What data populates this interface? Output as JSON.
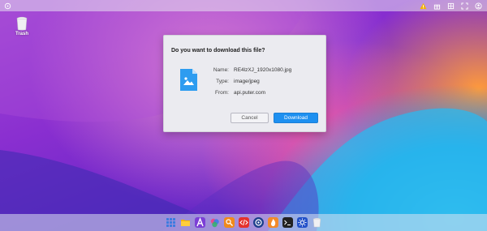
{
  "desktop": {
    "trash_label": "Trash"
  },
  "dialog": {
    "title": "Do you want to download this file?",
    "fields": [
      {
        "key": "Name:",
        "value": "RE4lzXJ_1920x1080.jpg"
      },
      {
        "key": "Type:",
        "value": "image/jpeg"
      },
      {
        "key": "From:",
        "value": "api.puter.com"
      }
    ],
    "cancel_label": "Cancel",
    "download_label": "Download"
  },
  "colors": {
    "accent": "#1e90f0",
    "file_icon": "#2d9cf0",
    "warning": "#f5b400"
  },
  "topbar": {
    "left_icon": "puter-logo-icon",
    "right_icons": [
      "warning-icon",
      "gift-icon",
      "grid-icon",
      "fullscreen-icon",
      "account-icon"
    ]
  },
  "dock": {
    "apps": [
      "app-launcher-icon",
      "files-icon",
      "editor-icon",
      "draw-icon",
      "terminal-icon",
      "code-icon",
      "dev-center-icon",
      "camera-icon",
      "recorder-icon",
      "terminal-2-icon",
      "settings-icon",
      "trash-icon"
    ]
  }
}
